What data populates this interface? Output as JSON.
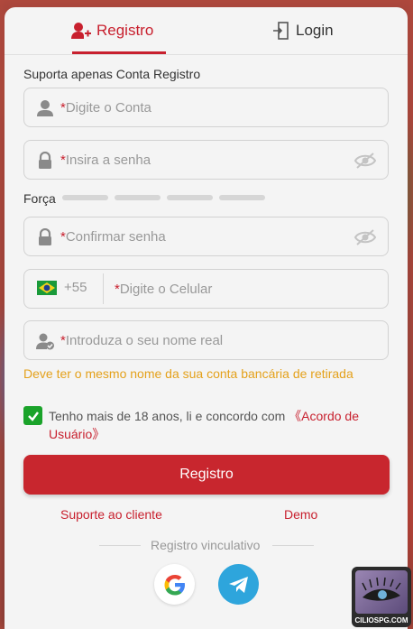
{
  "tabs": {
    "register": "Registro",
    "login": "Login"
  },
  "form": {
    "support_hint": "Suporta apenas Conta Registro",
    "account_placeholder": "Digite o Conta",
    "password_placeholder": "Insira a senha",
    "strength_label": "Força",
    "confirm_placeholder": "Confirmar senha",
    "country_code": "+55",
    "phone_placeholder": "Digite o Celular",
    "realname_placeholder": "Introduza o seu nome real",
    "required_mark": "*",
    "realname_warning": "Deve ter o mesmo nome da sua conta bancária de retirada",
    "terms_text": "Tenho mais de 18 anos, li e concordo com ",
    "terms_link": "《Acordo de Usuário》",
    "submit": "Registro"
  },
  "links": {
    "support": "Suporte ao cliente",
    "demo": "Demo"
  },
  "social": {
    "label": "Registro vinculativo"
  },
  "badge": {
    "text": "CILIOSPG.COM"
  },
  "colors": {
    "accent": "#c8202e",
    "warning": "#e4a11b",
    "check": "#1aa32a"
  }
}
